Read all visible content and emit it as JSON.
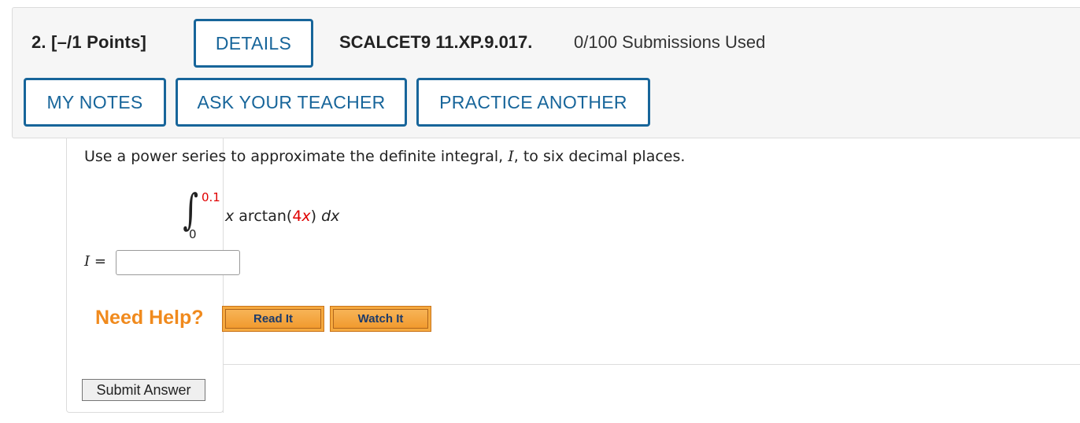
{
  "question": {
    "number_points": "2.  [–/1 Points]",
    "code": "SCALCET9 11.XP.9.017.",
    "submissions": "0/100 Submissions Used"
  },
  "buttons": {
    "details": "DETAILS",
    "my_notes": "MY NOTES",
    "ask_teacher": "ASK YOUR TEACHER",
    "practice_another": "PRACTICE ANOTHER"
  },
  "prompt": {
    "before_var": "Use a power series to approximate the definite integral, ",
    "var": "I",
    "after_var": ", to six decimal places."
  },
  "integral": {
    "upper_limit": "0.1",
    "lower_limit": "0",
    "integrand_x": "x",
    "integrand_func": " arctan(",
    "integrand_coef": "4x",
    "integrand_close": ") ",
    "integrand_dx": "dx"
  },
  "answer": {
    "label_var": "I",
    "label_eq": " =",
    "value": ""
  },
  "help": {
    "label": "Need Help?",
    "read_it": "Read It",
    "watch_it": "Watch It"
  },
  "submit": {
    "label": "Submit Answer"
  },
  "colors": {
    "accent_blue": "#17659a",
    "help_orange": "#f08a1d",
    "highlight_red": "#e00000"
  }
}
